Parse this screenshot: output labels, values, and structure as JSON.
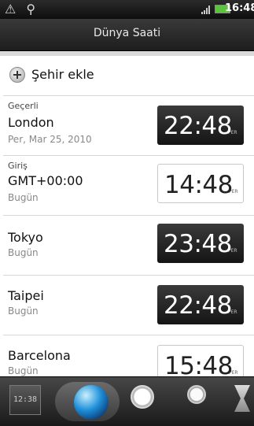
{
  "status_bar": {
    "left_icons": [
      "warning-icon",
      "usb-icon"
    ],
    "signal_icon": "signal-icon",
    "battery_icon": "battery-icon",
    "time": "16:48"
  },
  "header": {
    "title": "Dünya Saati"
  },
  "add_city": {
    "icon": "plus-icon",
    "label": "Şehir ekle"
  },
  "cities": [
    {
      "kind": "Geçerli",
      "name": "London",
      "sub": "Per, Mar 25, 2010",
      "time": "22:48",
      "ampm": "PER",
      "style": "dark"
    },
    {
      "kind": "Giriş",
      "name": "GMT+00:00",
      "sub": "Bugün",
      "time": "14:48",
      "ampm": "PER",
      "style": "light"
    },
    {
      "kind": "",
      "name": "Tokyo",
      "sub": "Bugün",
      "time": "23:48",
      "ampm": "PER",
      "style": "dark"
    },
    {
      "kind": "",
      "name": "Taipei",
      "sub": "Bugün",
      "time": "22:48",
      "ampm": "PER",
      "style": "dark"
    },
    {
      "kind": "",
      "name": "Barcelona",
      "sub": "Bugün",
      "time": "15:48",
      "ampm": "PER",
      "style": "light"
    }
  ],
  "dock": {
    "clock_tab_text": "12:38",
    "tabs": [
      "desk-clock-icon",
      "world-clock-globe-icon",
      "alarm-clock-icon",
      "stopwatch-icon",
      "timer-hourglass-icon"
    ],
    "selected": "world-clock-globe-icon"
  },
  "colors": {
    "battery": "#5cc43a",
    "globe": "#1f8fd8"
  }
}
